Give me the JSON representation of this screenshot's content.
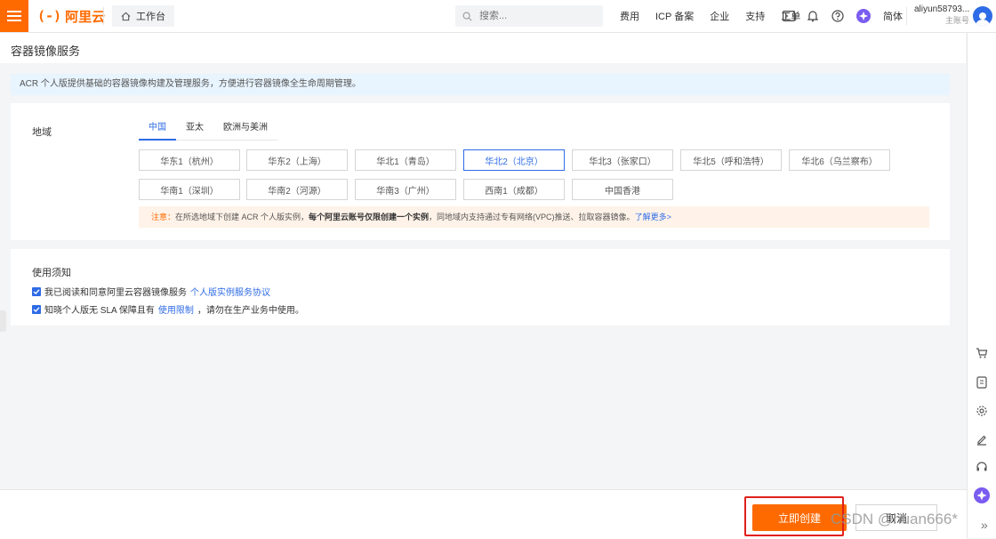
{
  "topbar": {
    "logo_mark": "(-)",
    "logo_text": "阿里云",
    "workbench_label": "工作台",
    "search_placeholder": "搜索...",
    "nav_items": [
      "费用",
      "ICP 备案",
      "企业",
      "支持",
      "工单"
    ],
    "lang_label": "简体",
    "user_name": "aliyun58793...",
    "user_role": "主账号"
  },
  "page": {
    "title": "容器镜像服务",
    "notice": "ACR 个人版提供基础的容器镜像构建及管理服务，方便进行容器镜像全生命周期管理。"
  },
  "region_section": {
    "label": "地域",
    "tabs": [
      "中国",
      "亚太",
      "欧洲与美洲"
    ],
    "active_tab": "中国",
    "regions": [
      "华东1（杭州）",
      "华东2（上海）",
      "华北1（青岛）",
      "华北2（北京）",
      "华北3（张家口）",
      "华北5（呼和浩特）",
      "华北6（乌兰察布）",
      "华南1（深圳）",
      "华南2（河源）",
      "华南3（广州）",
      "西南1（成都）",
      "中国香港"
    ],
    "selected_region": "华北2（北京）",
    "warning": {
      "prefix": "注意：",
      "text1": "在所选地域下创建 ACR 个人版实例，",
      "bold": "每个阿里云账号仅限创建一个实例",
      "text2": "，同地域内支持通过专有网络(VPC)推送、拉取容器镜像。",
      "link": "了解更多>"
    }
  },
  "usage_section": {
    "title": "使用须知",
    "check1_text": "我已阅读和同意阿里云容器镜像服务",
    "check1_link": "个人版实例服务协议",
    "check2_text_a": "知晓个人版无 SLA 保障且有",
    "check2_link": "使用限制",
    "check2_text_b": "，请勿在生产业务中使用。"
  },
  "footer": {
    "create_label": "立即创建",
    "cancel_label": "取消"
  },
  "watermark": "CSDN @huan666*",
  "colors": {
    "brand_orange": "#ff6a00",
    "link_blue": "#2e6be6",
    "highlight_red": "#e0201b"
  }
}
